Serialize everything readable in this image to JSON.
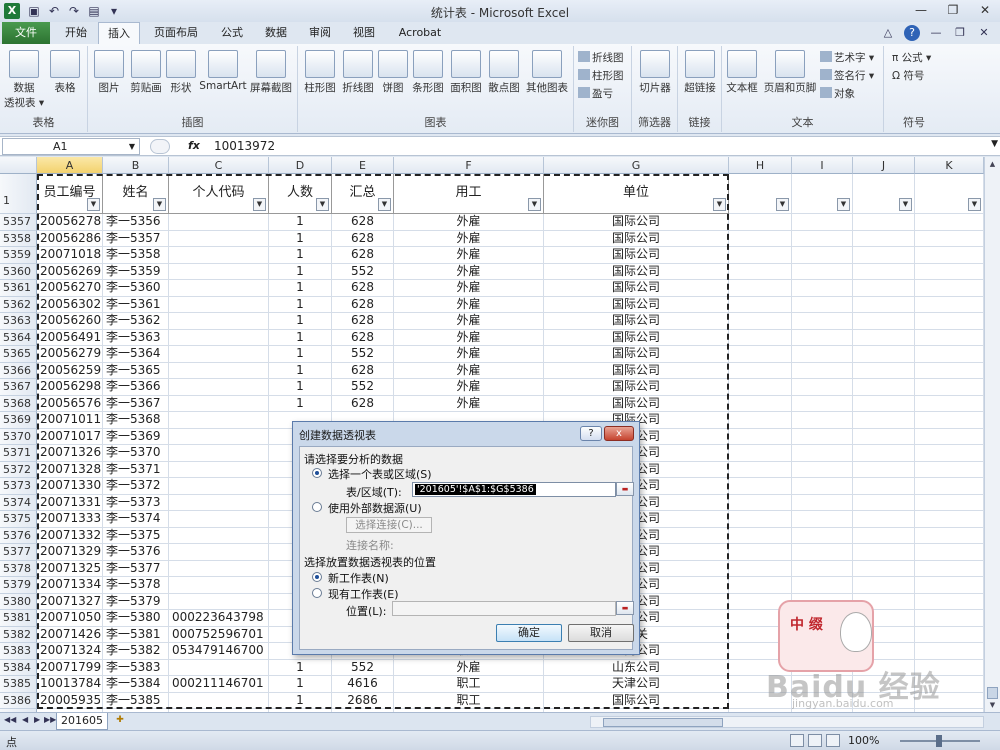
{
  "window": {
    "title": "统计表 - Microsoft Excel",
    "app_badge": "X"
  },
  "tabs": [
    {
      "label": "文件"
    },
    {
      "label": "开始"
    },
    {
      "label": "插入"
    },
    {
      "label": "页面布局"
    },
    {
      "label": "公式"
    },
    {
      "label": "数据"
    },
    {
      "label": "审阅"
    },
    {
      "label": "视图"
    },
    {
      "label": "Acrobat"
    }
  ],
  "ribbon": {
    "groups": [
      "表格",
      "插图",
      "图表",
      "迷你图",
      "筛选器",
      "链接",
      "文本",
      "符号"
    ],
    "tables": [
      "数据\n透视表 ▾",
      "表格"
    ],
    "illustrations": [
      "图片",
      "剪贴画",
      "形状",
      "SmartArt",
      "屏幕截图"
    ],
    "charts": [
      "柱形图",
      "折线图",
      "饼图",
      "条形图",
      "面积图",
      "散点图",
      "其他图表"
    ],
    "sparklines": [
      "折线图",
      "柱形图",
      "盈亏"
    ],
    "filter": "切片器",
    "links": "超链接",
    "text": [
      "文本框",
      "页眉和页脚"
    ],
    "text_small": [
      "艺术字 ▾",
      "签名行 ▾",
      "对象"
    ],
    "symbols": [
      "公式 ▾",
      "符号"
    ]
  },
  "formula_bar": {
    "name_box": "A1",
    "fx": "fx",
    "value": "10013972"
  },
  "columns": [
    "A",
    "B",
    "C",
    "D",
    "E",
    "F",
    "G",
    "H",
    "I",
    "J",
    "K"
  ],
  "header_row_num": "1",
  "headers": [
    "员工编号",
    "姓名",
    "个人代码",
    "人数",
    "汇总",
    "用工",
    "单位"
  ],
  "rows": [
    {
      "n": "5357",
      "a": "20056278",
      "b": "李一5356",
      "c": "",
      "d": "1",
      "e": "628",
      "f": "外雇",
      "g": "国际公司"
    },
    {
      "n": "5358",
      "a": "20056286",
      "b": "李一5357",
      "c": "",
      "d": "1",
      "e": "628",
      "f": "外雇",
      "g": "国际公司"
    },
    {
      "n": "5359",
      "a": "20071018",
      "b": "李一5358",
      "c": "",
      "d": "1",
      "e": "628",
      "f": "外雇",
      "g": "国际公司"
    },
    {
      "n": "5360",
      "a": "20056269",
      "b": "李一5359",
      "c": "",
      "d": "1",
      "e": "552",
      "f": "外雇",
      "g": "国际公司"
    },
    {
      "n": "5361",
      "a": "20056270",
      "b": "李一5360",
      "c": "",
      "d": "1",
      "e": "628",
      "f": "外雇",
      "g": "国际公司"
    },
    {
      "n": "5362",
      "a": "20056302",
      "b": "李一5361",
      "c": "",
      "d": "1",
      "e": "628",
      "f": "外雇",
      "g": "国际公司"
    },
    {
      "n": "5363",
      "a": "20056260",
      "b": "李一5362",
      "c": "",
      "d": "1",
      "e": "628",
      "f": "外雇",
      "g": "国际公司"
    },
    {
      "n": "5364",
      "a": "20056491",
      "b": "李一5363",
      "c": "",
      "d": "1",
      "e": "628",
      "f": "外雇",
      "g": "国际公司"
    },
    {
      "n": "5365",
      "a": "20056279",
      "b": "李一5364",
      "c": "",
      "d": "1",
      "e": "552",
      "f": "外雇",
      "g": "国际公司"
    },
    {
      "n": "5366",
      "a": "20056259",
      "b": "李一5365",
      "c": "",
      "d": "1",
      "e": "628",
      "f": "外雇",
      "g": "国际公司"
    },
    {
      "n": "5367",
      "a": "20056298",
      "b": "李一5366",
      "c": "",
      "d": "1",
      "e": "552",
      "f": "外雇",
      "g": "国际公司"
    },
    {
      "n": "5368",
      "a": "20056576",
      "b": "李一5367",
      "c": "",
      "d": "1",
      "e": "628",
      "f": "外雇",
      "g": "国际公司"
    },
    {
      "n": "5369",
      "a": "20071011",
      "b": "李一5368",
      "c": "",
      "d": "",
      "e": "",
      "f": "",
      "g": "国际公司"
    },
    {
      "n": "5370",
      "a": "20071017",
      "b": "李一5369",
      "c": "",
      "d": "",
      "e": "",
      "f": "",
      "g": "国际公司"
    },
    {
      "n": "5371",
      "a": "20071326",
      "b": "李一5370",
      "c": "",
      "d": "",
      "e": "",
      "f": "",
      "g": "国际公司"
    },
    {
      "n": "5372",
      "a": "20071328",
      "b": "李一5371",
      "c": "",
      "d": "",
      "e": "",
      "f": "",
      "g": "国际公司"
    },
    {
      "n": "5373",
      "a": "20071330",
      "b": "李一5372",
      "c": "",
      "d": "",
      "e": "",
      "f": "",
      "g": "国际公司"
    },
    {
      "n": "5374",
      "a": "20071331",
      "b": "李一5373",
      "c": "",
      "d": "",
      "e": "",
      "f": "",
      "g": "国际公司"
    },
    {
      "n": "5375",
      "a": "20071333",
      "b": "李一5374",
      "c": "",
      "d": "",
      "e": "",
      "f": "",
      "g": "国际公司"
    },
    {
      "n": "5376",
      "a": "20071332",
      "b": "李一5375",
      "c": "",
      "d": "",
      "e": "",
      "f": "",
      "g": "国际公司"
    },
    {
      "n": "5377",
      "a": "20071329",
      "b": "李一5376",
      "c": "",
      "d": "",
      "e": "",
      "f": "",
      "g": "国际公司"
    },
    {
      "n": "5378",
      "a": "20071325",
      "b": "李一5377",
      "c": "",
      "d": "",
      "e": "",
      "f": "",
      "g": "国际公司"
    },
    {
      "n": "5379",
      "a": "20071334",
      "b": "李一5378",
      "c": "",
      "d": "",
      "e": "",
      "f": "",
      "g": "国际公司"
    },
    {
      "n": "5380",
      "a": "20071327",
      "b": "李一5379",
      "c": "",
      "d": "",
      "e": "",
      "f": "",
      "g": "国际公司"
    },
    {
      "n": "5381",
      "a": "20071050",
      "b": "李一5380",
      "c": "000223643798",
      "d": "",
      "e": "",
      "f": "",
      "g": "国际公司"
    },
    {
      "n": "5382",
      "a": "20071426",
      "b": "李一5381",
      "c": "000752596701",
      "d": "",
      "e": "",
      "f": "",
      "g": "机关"
    },
    {
      "n": "5383",
      "a": "20071324",
      "b": "李一5382",
      "c": "053479146700",
      "d": "1",
      "e": "4616",
      "f": "职工",
      "g": "海南公司"
    },
    {
      "n": "5384",
      "a": "20071799",
      "b": "李一5383",
      "c": "",
      "d": "1",
      "e": "552",
      "f": "外雇",
      "g": "山东公司"
    },
    {
      "n": "5385",
      "a": "10013784",
      "b": "李一5384",
      "c": "000211146701",
      "d": "1",
      "e": "4616",
      "f": "职工",
      "g": "天津公司"
    },
    {
      "n": "5386",
      "a": "20005935",
      "b": "李一5385",
      "c": "",
      "d": "1",
      "e": "2686",
      "f": "职工",
      "g": "国际公司"
    },
    {
      "n": "5387",
      "a": "",
      "b": "",
      "c": "",
      "d": "",
      "e": "",
      "f": "",
      "g": ""
    }
  ],
  "sheet_tab": "201605",
  "status": {
    "ready": "点",
    "zoom": "100%"
  },
  "dialog": {
    "title": "创建数据透视表",
    "help": "?",
    "close": "x",
    "section1": "请选择要分析的数据",
    "opt_range": "选择一个表或区域(S)",
    "range_label": "表/区域(T):",
    "range_value": "'201605'!$A$1:$G$5386",
    "opt_external": "使用外部数据源(U)",
    "select_conn": "选择连接(C)...",
    "conn_name": "连接名称:",
    "section2": "选择放置数据透视表的位置",
    "opt_new": "新工作表(N)",
    "opt_existing": "现有工作表(E)",
    "location_label": "位置(L):",
    "ok": "确定",
    "cancel": "取消"
  },
  "watermark": {
    "brand": "Baidu 经验",
    "url": "jingyan.baidu.com",
    "sticker_text": "中 缀"
  }
}
